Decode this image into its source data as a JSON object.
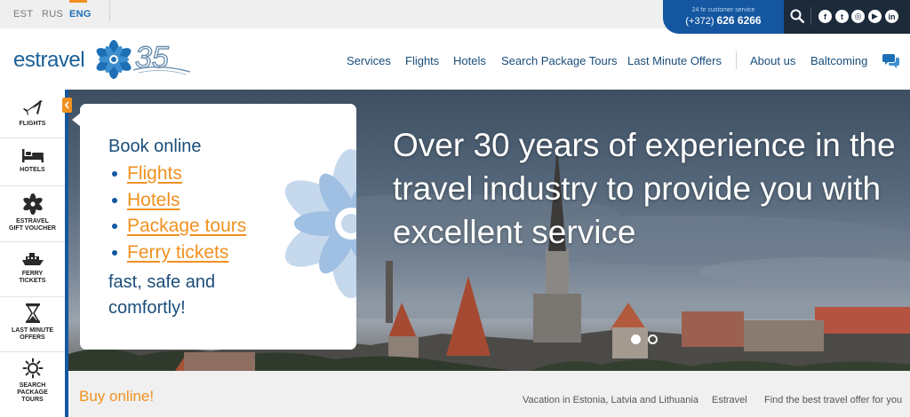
{
  "topbar": {
    "languages": [
      "EST",
      "RUS",
      "ENG"
    ],
    "active_language": "ENG",
    "service_label": "24 hr customer service",
    "service_phone_prefix": "(+372)",
    "service_phone": "626 6266"
  },
  "social": [
    "facebook-icon",
    "twitter-icon",
    "instagram-icon",
    "youtube-icon",
    "linkedin-icon"
  ],
  "header": {
    "logo_text": "estravel",
    "anniversary": "35",
    "nav": [
      "Services",
      "Flights",
      "Hotels",
      "Search Package Tours",
      "Last Minute Offers",
      "About us",
      "Baltcoming"
    ]
  },
  "rail": {
    "flights": "FLIGHTS",
    "hotels": "HOTELS",
    "voucher_1": "ESTRAVEL",
    "voucher_2": "GIFT VOUCHER",
    "ferry_1": "FERRY",
    "ferry_2": "TICKETS",
    "lastminute_1": "LAST MINUTE",
    "lastminute_2": "OFFERS",
    "search_1": "SEARCH",
    "search_2": "PACKAGE",
    "search_3": "TOURS"
  },
  "hero": {
    "headline": "Over 30 years of experience in the travel industry to provide you with excellent service",
    "slides": 2,
    "active_slide": 1
  },
  "card": {
    "title": "Book online",
    "links": [
      "Flights",
      "Hotels",
      "Package tours",
      "Ferry tickets"
    ],
    "tagline": "fast, safe and comfortly!"
  },
  "footer": {
    "buy": "Buy online!",
    "links": [
      "Vacation in Estonia, Latvia and Lithuania",
      "Estravel",
      "Find the best travel offer for you"
    ]
  },
  "colors": {
    "brand_blue": "#1457a0",
    "accent_orange": "#f19120",
    "dark_bar": "#1c2a3a"
  }
}
